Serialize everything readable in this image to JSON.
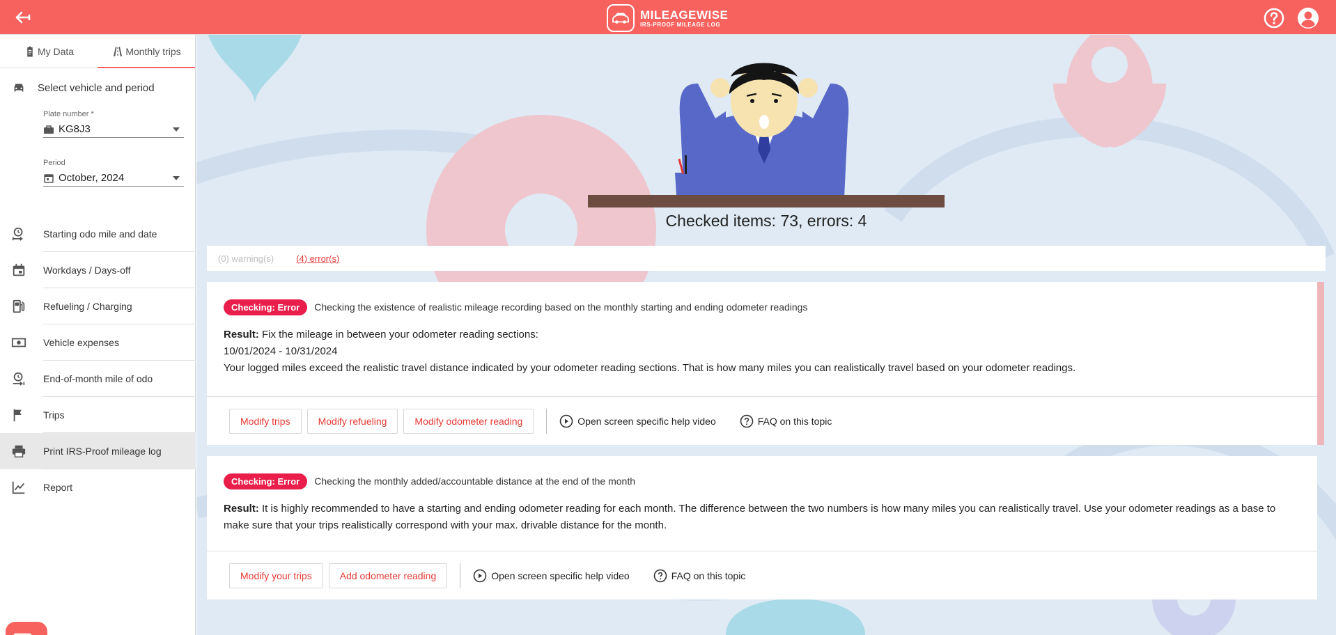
{
  "header": {
    "logo_title": "MILEAGEWISE",
    "logo_subtitle": "IRS-PROOF MILEAGE LOG",
    "back_icon": "arrow-left-icon",
    "help_icon": "help-circle-icon",
    "account_icon": "account-circle-icon",
    "bar_color": "#f7625f"
  },
  "sidebar": {
    "tabs": [
      {
        "label": "My Data",
        "icon": "clipboard-icon",
        "active": false
      },
      {
        "label": "Monthly trips",
        "icon": "road-icon",
        "active": true
      }
    ],
    "vehicle_section": {
      "title": "Select vehicle and period",
      "plate_label": "Plate number *",
      "plate_value": "KG8J3",
      "period_label": "Period",
      "period_value": "October, 2024"
    },
    "items": [
      {
        "label": "Starting odo mile and date",
        "icon": "odometer-start-icon"
      },
      {
        "label": "Workdays / Days-off",
        "icon": "calendar-icon"
      },
      {
        "label": "Refueling / Charging",
        "icon": "fuel-icon"
      },
      {
        "label": "Vehicle expenses",
        "icon": "cash-icon"
      },
      {
        "label": "End-of-month mile of odo",
        "icon": "odometer-end-icon"
      },
      {
        "label": "Trips",
        "icon": "flag-icon"
      },
      {
        "label": "Print IRS-Proof mileage log",
        "icon": "printer-icon",
        "selected": true
      },
      {
        "label": "Report",
        "icon": "chart-line-icon"
      }
    ],
    "chat_icon": "chat-icon"
  },
  "main": {
    "checked_text": "Checked items: 73, errors: 4",
    "filters": {
      "warnings": "(0) warning(s)",
      "errors": "(4) error(s)"
    },
    "cards": [
      {
        "badge": "Checking: Error",
        "title": "Checking the existence of realistic mileage recording based on the monthly starting and ending odometer readings",
        "result_label": "Result:",
        "result_text": " Fix the mileage in between your odometer reading sections:",
        "line2": "10/01/2024 - 10/31/2024",
        "line3": "Your logged miles exceed the realistic travel distance indicated by your odometer reading sections. That is how many miles you can realistically travel based on your odometer readings.",
        "buttons": [
          "Modify trips",
          "Modify refueling",
          "Modify odometer reading"
        ],
        "help_video": "Open screen specific help video",
        "faq": "FAQ on this topic"
      },
      {
        "badge": "Checking: Error",
        "title": "Checking the monthly added/accountable distance at the end of the month",
        "result_label": "Result:",
        "result_text": " It is highly recommended to have a starting and ending odometer reading for each month. The difference between the two numbers is how many miles you can realistically travel. Use your odometer readings as a base to make sure that your trips realistically correspond with your max. drivable distance for the month.",
        "buttons": [
          "Modify your trips",
          "Add odometer reading"
        ],
        "help_video": "Open screen specific help video",
        "faq": "FAQ on this topic"
      }
    ]
  }
}
